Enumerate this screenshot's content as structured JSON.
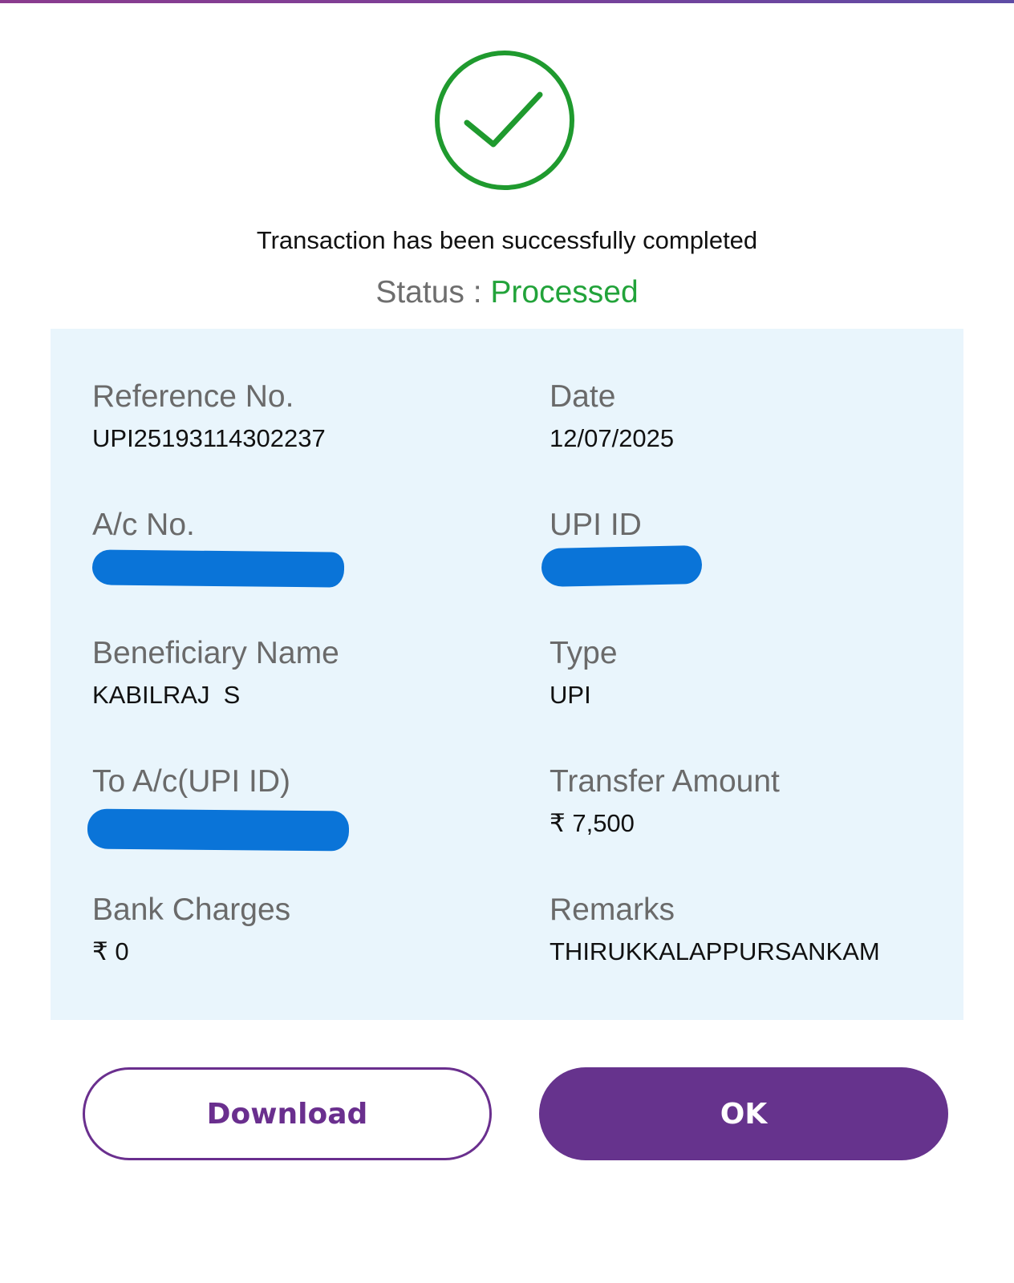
{
  "colors": {
    "brand_purple": "#66338d",
    "success_green": "#22a33a",
    "card_background": "#e9f5fc",
    "redaction_blue": "#0a74d8"
  },
  "header": {
    "icon": "success-check-icon",
    "message": "Transaction has been successfully completed",
    "status_label": "Status : ",
    "status_value": "Processed"
  },
  "details": {
    "reference_no": {
      "label": "Reference No.",
      "value": "UPI25193114302237"
    },
    "date": {
      "label": "Date",
      "value": "12/07/2025"
    },
    "ac_no": {
      "label": "A/c No.",
      "value_redacted": true
    },
    "upi_id": {
      "label": "UPI ID",
      "value_redacted": true
    },
    "beneficiary_name": {
      "label": "Beneficiary Name",
      "value": "KABILRAJ  S"
    },
    "type": {
      "label": "Type",
      "value": "UPI"
    },
    "to_ac": {
      "label": "To A/c(UPI ID)",
      "value_redacted": true
    },
    "transfer_amount": {
      "label": "Transfer Amount",
      "value": "₹ 7,500"
    },
    "bank_charges": {
      "label": "Bank Charges",
      "value": "₹ 0"
    },
    "remarks": {
      "label": "Remarks",
      "value": "THIRUKKALAPPURSANKAM"
    }
  },
  "actions": {
    "download_label": "Download",
    "ok_label": "OK"
  }
}
